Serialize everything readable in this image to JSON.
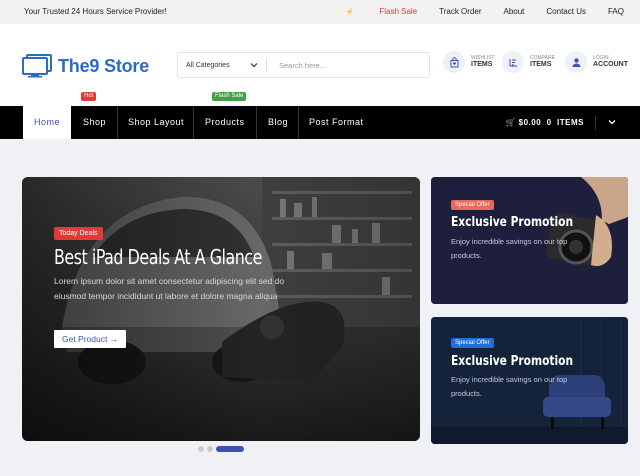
{
  "topbar": {
    "tagline": "Your Trusted 24 Hours Service Provider!",
    "links": {
      "flash_sale": "Flash Sale",
      "track_order": "Track Order",
      "about": "About",
      "contact": "Contact Us",
      "faq": "FAQ"
    },
    "flash_color": "#e53935"
  },
  "header": {
    "logo_text": "The9 Store",
    "search": {
      "category": "All Categories",
      "placeholder": "Search here..."
    },
    "icons": {
      "wishlist": {
        "small": "WISHLIST",
        "big": "ITEMS",
        "icon": "wishlist-bag-icon"
      },
      "compare": {
        "small": "COMPARE",
        "big": "ITEMS",
        "icon": "compare-icon"
      },
      "account": {
        "small": "LOGIN",
        "big": "ACCOUNT",
        "icon": "user-icon"
      }
    },
    "brand_color": "#2b6cc4"
  },
  "nav": {
    "items": {
      "home": "Home",
      "shop": "Shop",
      "shop_layout": "Shop Layout",
      "products": "Products",
      "blog": "Blog",
      "post_format": "Post Format"
    },
    "badges": {
      "hot": "Hot",
      "flash_sale": "Flash Sale"
    },
    "cart": {
      "amount": "$0.00",
      "count": "0",
      "label": "ITEMS"
    },
    "accent": "#3f51b5"
  },
  "hero": {
    "tag": "Today Deals",
    "title": "Best iPad Deals At A Glance",
    "description": "Lorem ipsum dolor sit amet consectetur adipiscing elit sed do eiusmod tempor incididunt ut labore et dolore magna aliqua",
    "button": "Get Product",
    "slides": 3,
    "active_slide": 3
  },
  "promos": [
    {
      "tag": "Special Offer",
      "title": "Exclusive Promotion",
      "description": "Enjoy incredible savings on our top products.",
      "tag_color": "#e8685a"
    },
    {
      "tag": "Special Offer",
      "title": "Exclusive Promotion",
      "description": "Enjoy incredible savings on our top products.",
      "tag_color": "#1e6fd9"
    }
  ]
}
